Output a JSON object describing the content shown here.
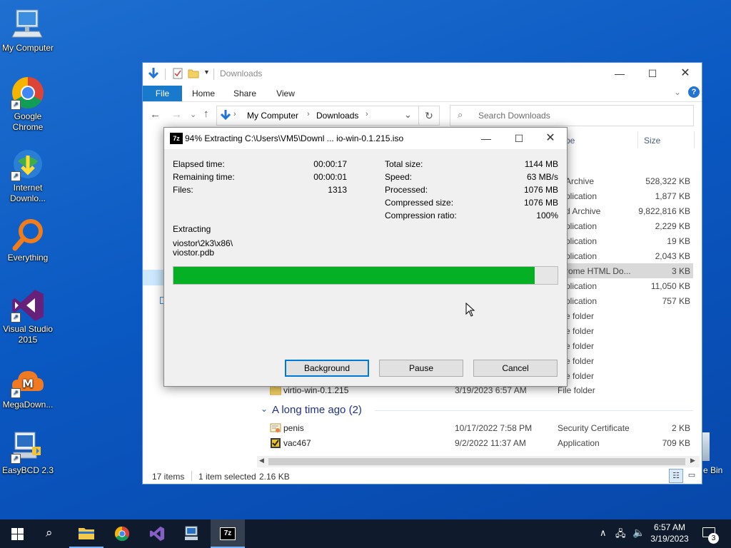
{
  "desktop": {
    "icons": [
      {
        "label": "My Computer"
      },
      {
        "label": "Google\nChrome"
      },
      {
        "label": "Internet\nDownlo..."
      },
      {
        "label": "Everything"
      },
      {
        "label": "Visual Studio\n2015"
      },
      {
        "label": "MegaDown..."
      },
      {
        "label": "EasyBCD 2.3"
      },
      {
        "label": "e Bin"
      }
    ]
  },
  "explorer": {
    "title": "Downloads",
    "ribbon_tabs": [
      "File",
      "Home",
      "Share",
      "View"
    ],
    "address": {
      "root": "My Computer",
      "folder": "Downloads"
    },
    "search_placeholder": "Search Downloads",
    "columns": {
      "type": "pe",
      "size": "Size"
    },
    "rows_right": [
      {
        "type": "Archive",
        "size": "528,322 KB"
      },
      {
        "type": "plication",
        "size": "1,877 KB"
      },
      {
        "type": "d Archive",
        "size": "9,822,816 KB"
      },
      {
        "type": "plication",
        "size": "2,229 KB"
      },
      {
        "type": "plication",
        "size": "19 KB"
      },
      {
        "type": "plication",
        "size": "2,043 KB"
      },
      {
        "type": "rome HTML Do...",
        "size": "3 KB"
      },
      {
        "type": "plication",
        "size": "11,050 KB"
      },
      {
        "type": "plication",
        "size": "757 KB"
      },
      {
        "type": "e folder",
        "size": ""
      },
      {
        "type": "e folder",
        "size": ""
      },
      {
        "type": "e folder",
        "size": ""
      },
      {
        "type": "e folder",
        "size": ""
      },
      {
        "type": "e folder",
        "size": ""
      }
    ],
    "virtio_row": {
      "name": "virtio-win-0.1.215",
      "date": "3/19/2023 6:57 AM",
      "type": "File folder",
      "size": ""
    },
    "group_header": "A long time ago (2)",
    "old_rows": [
      {
        "name": "penis",
        "date": "10/17/2022 7:58 PM",
        "type": "Security Certificate",
        "size": "2 KB"
      },
      {
        "name": "vac467",
        "date": "9/2/2022 11:37 AM",
        "type": "Application",
        "size": "709 KB"
      }
    ],
    "status": {
      "items": "17 items",
      "selected": "1 item selected",
      "size": "2.16 KB"
    }
  },
  "dialog": {
    "title": "94% Extracting C:\\Users\\VM5\\Downl ... io-win-0.1.215.iso",
    "left_stats": [
      {
        "label": "Elapsed time:",
        "value": "00:00:17"
      },
      {
        "label": "Remaining time:",
        "value": "00:00:01"
      },
      {
        "label": "Files:",
        "value": "1313"
      }
    ],
    "right_stats": [
      {
        "label": "Total size:",
        "value": "1144 MB"
      },
      {
        "label": "Speed:",
        "value": "63 MB/s"
      },
      {
        "label": "Processed:",
        "value": "1076 MB"
      },
      {
        "label": "Compressed size:",
        "value": "1076 MB"
      },
      {
        "label": "Compression ratio:",
        "value": "100%"
      }
    ],
    "action": "Extracting",
    "path_line1": "viostor\\2k3\\x86\\",
    "path_line2": "viostor.pdb",
    "progress": 0.94,
    "buttons": {
      "background": "Background",
      "pause": "Pause",
      "cancel": "Cancel"
    }
  },
  "taskbar": {
    "time": "6:57 AM",
    "date": "3/19/2023",
    "notification_count": "3"
  },
  "colors": {
    "progress": "#06b025",
    "accent": "#0078d7",
    "taskbar": "#0f1b2c"
  }
}
